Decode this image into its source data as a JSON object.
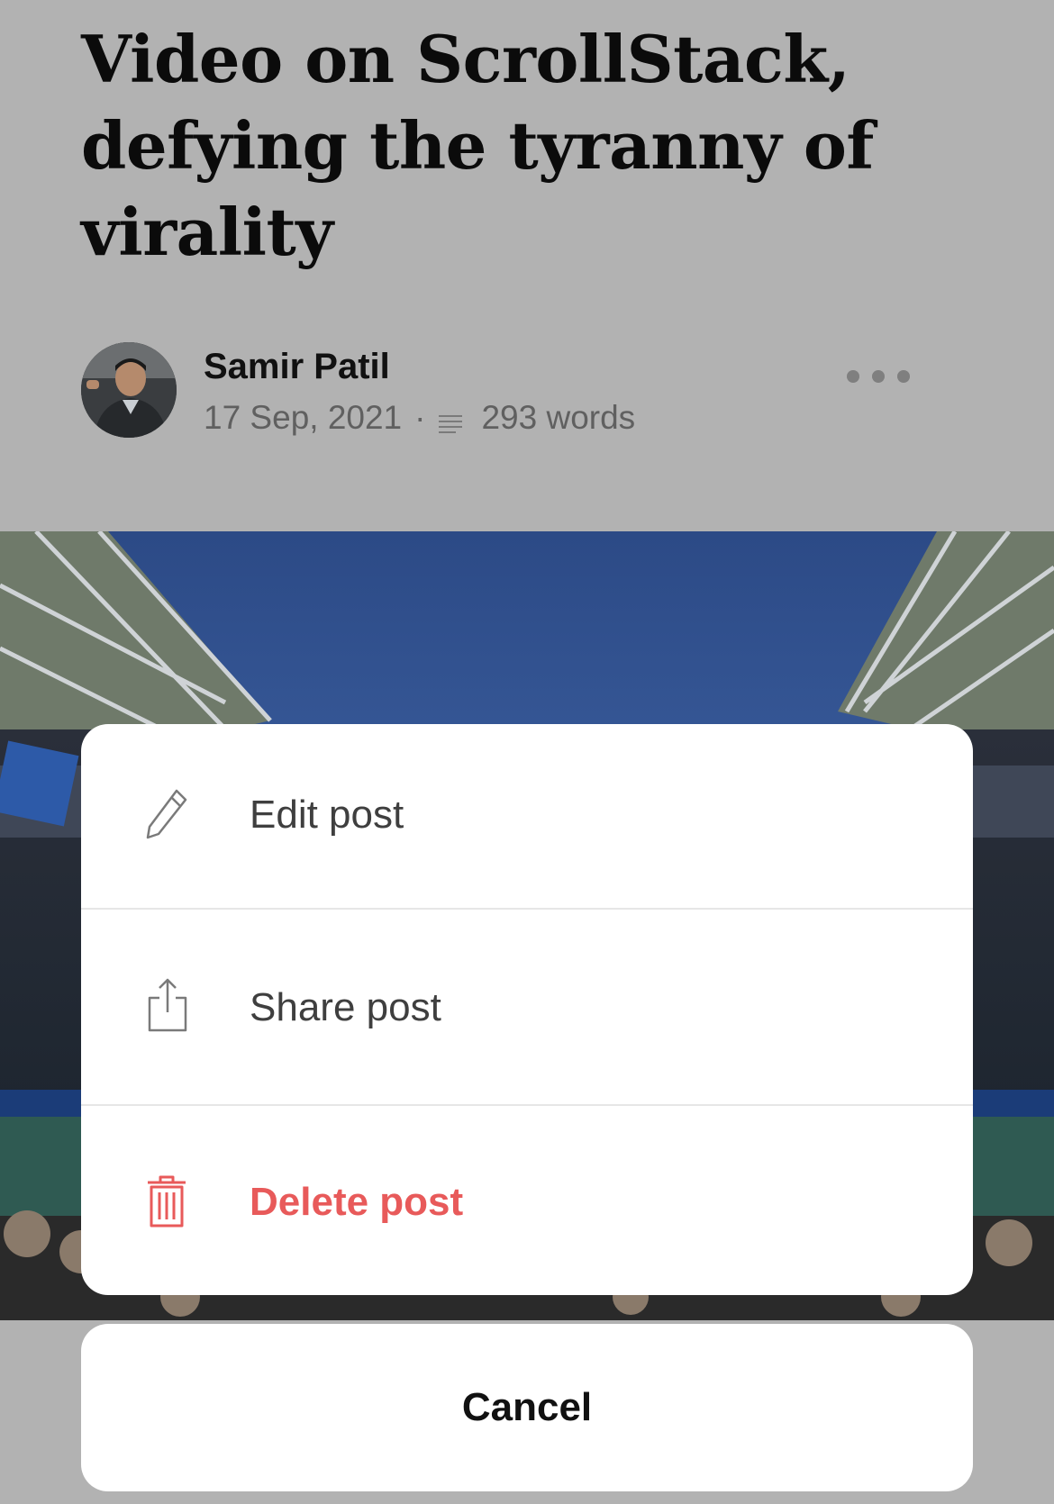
{
  "post": {
    "title": "Video on ScrollStack, defying the tyranny of virality",
    "author_name": "Samir Patil",
    "date": "17 Sep, 2021",
    "separator": "·",
    "word_count": "293 words"
  },
  "action_sheet": {
    "items": [
      {
        "label": "Edit post",
        "icon": "pencil-icon"
      },
      {
        "label": "Share post",
        "icon": "share-icon"
      },
      {
        "label": "Delete post",
        "icon": "trash-icon"
      }
    ],
    "cancel_label": "Cancel"
  },
  "colors": {
    "overlay_background": "#b2b2b2",
    "sheet_background": "#ffffff",
    "danger": "#e85a5a",
    "text_primary": "#111111",
    "text_secondary": "#606060"
  },
  "icons": {
    "more": "more-dots-icon",
    "word_count": "word-count-icon",
    "avatar": "author-avatar"
  }
}
